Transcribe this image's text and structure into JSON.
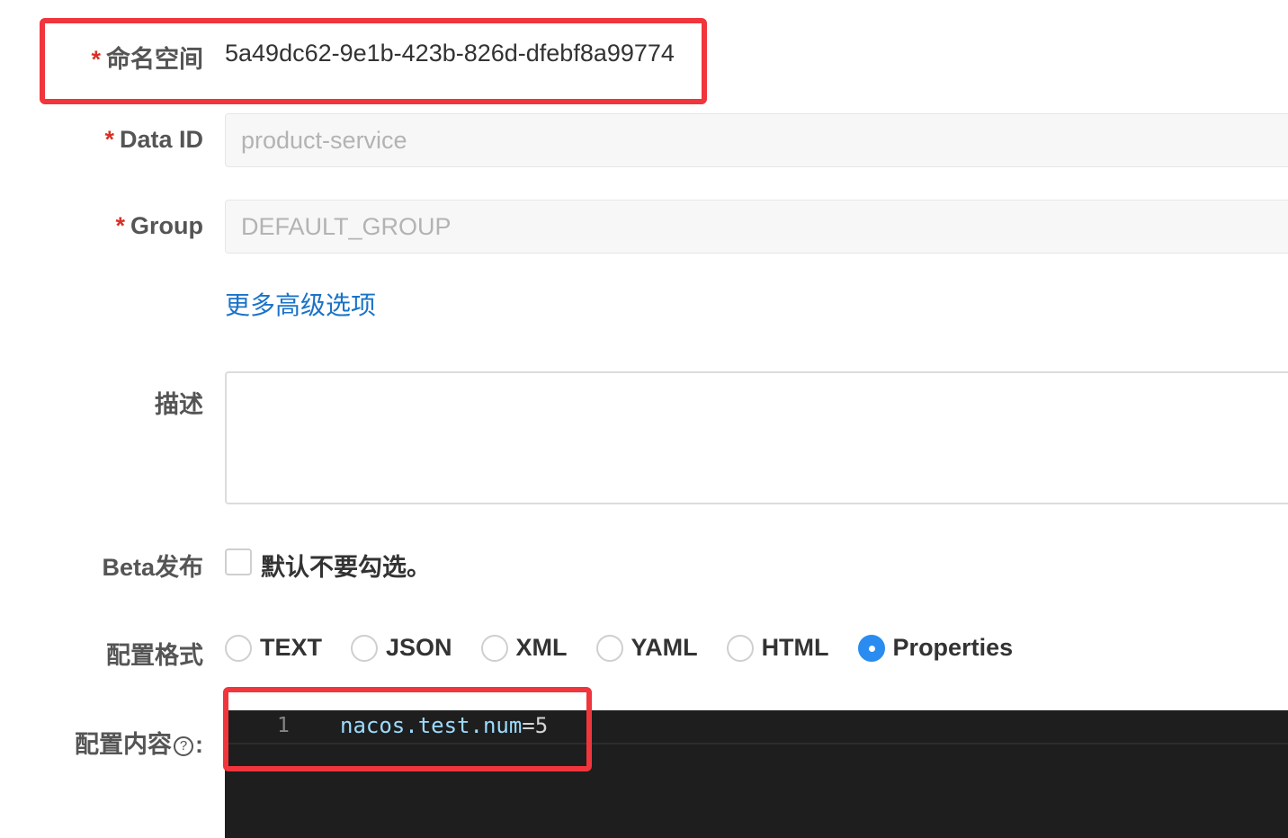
{
  "form": {
    "namespace": {
      "required_mark": "*",
      "label": "命名空间",
      "value": "5a49dc62-9e1b-423b-826d-dfebf8a99774"
    },
    "data_id": {
      "required_mark": "*",
      "label": "Data ID",
      "placeholder": "product-service"
    },
    "group": {
      "required_mark": "*",
      "label": "Group",
      "placeholder": "DEFAULT_GROUP"
    },
    "advanced_link": "更多高级选项",
    "description": {
      "label": "描述",
      "value": ""
    },
    "beta": {
      "label": "Beta发布",
      "checkbox_label": "默认不要勾选。",
      "checked": false
    },
    "format": {
      "label": "配置格式",
      "options": [
        {
          "label": "TEXT",
          "checked": false
        },
        {
          "label": "JSON",
          "checked": false
        },
        {
          "label": "XML",
          "checked": false
        },
        {
          "label": "YAML",
          "checked": false
        },
        {
          "label": "HTML",
          "checked": false
        },
        {
          "label": "Properties",
          "checked": true
        }
      ]
    },
    "content": {
      "label": "配置内容",
      "help_icon": "question-circle-icon",
      "colon": ":",
      "lines": [
        {
          "number": "1",
          "key": "nacos.test.num",
          "operator": "=",
          "value": "5"
        }
      ]
    }
  },
  "colors": {
    "accent": "#2a8cf0",
    "link": "#1a73c8",
    "required": "#d93026",
    "highlight_box": "#f0353c",
    "editor_bg": "#1e1e1e"
  }
}
